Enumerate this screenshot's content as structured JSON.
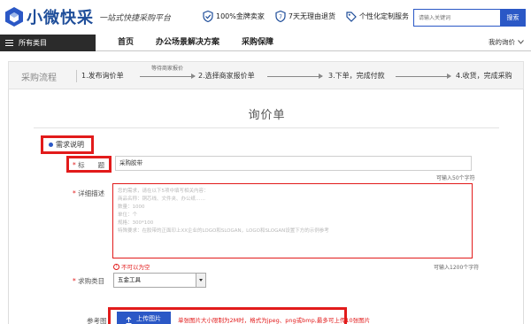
{
  "header": {
    "brand": "小微快采",
    "slogan": "一站式快捷采购平台",
    "promises": [
      {
        "icon": "shield-check-icon",
        "label": "100%金牌卖家"
      },
      {
        "icon": "shield-7-icon",
        "label": "7天无理由退货"
      },
      {
        "icon": "tag-icon",
        "label": "个性化定制服务"
      }
    ],
    "search": {
      "placeholder": "请输入关键词",
      "button": "搜索"
    }
  },
  "nav": {
    "all_categories": "所有类目",
    "items": [
      "首页",
      "办公场景解决方案",
      "采购保障"
    ],
    "my_inquiry": "我的询价"
  },
  "process": {
    "title": "采购流程",
    "steps": [
      "1.发布询价单",
      "2.选择商家报价单",
      "3.下单，完成付款",
      "4.收货，完成采购"
    ],
    "arrow_note": "等待商家报价"
  },
  "form": {
    "title": "询价单",
    "section_label": "需求说明",
    "title_field": {
      "label": "标　　题",
      "required_mark": "*",
      "value": "采购胶带",
      "hint": "可输入50个字符"
    },
    "desc_field": {
      "label": "详细描述",
      "required_mark": "*",
      "placeholder_lines": [
        "您的需求，请在以下5项中填写相关内容：",
        "商品名称：铜芯线、文件夹、办公纸……",
        "数量：1000",
        "单位：个",
        "规格：300*100",
        "特殊要求：在胶带的正面印上XX企业的LOGO和SLOGAN，LOGO和SLOGAN设置下方的示例参考"
      ],
      "error": "不可以为空",
      "hint": "可输入1200个字符"
    },
    "category_field": {
      "label": "求购类目",
      "required_mark": "*",
      "value": "五金工具"
    },
    "reference_field": {
      "label": "参考图",
      "upload_button": "上传图片",
      "note": "单张图片大小限制为2M时，格式为jpeg、png或bmp,最多可上传10张图片"
    }
  },
  "colors": {
    "brand_blue": "#2b58c6",
    "annotation_red": "#e21b1b",
    "nav_dark": "#2b2b2b"
  }
}
